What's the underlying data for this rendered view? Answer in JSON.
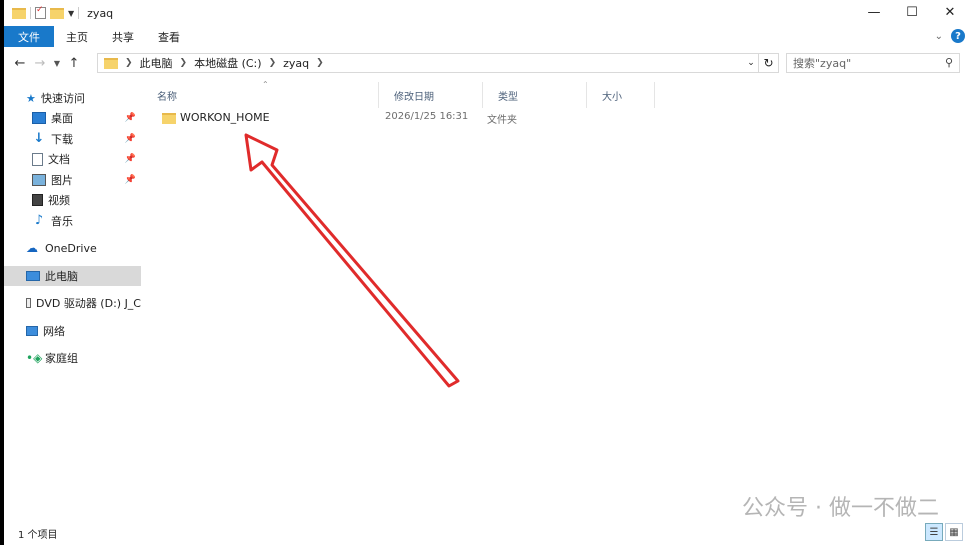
{
  "window": {
    "title": "zyaq",
    "controls": {
      "minimize": "—",
      "maximize": "☐",
      "close": "✕"
    }
  },
  "ribbon": {
    "tabs": [
      "文件",
      "主页",
      "共享",
      "查看"
    ],
    "help": "?"
  },
  "address": {
    "crumbs": [
      "此电脑",
      "本地磁盘 (C:)",
      "zyaq"
    ]
  },
  "search": {
    "placeholder": "搜索\"zyaq\""
  },
  "nav": {
    "quick_access": "快速访问",
    "items": [
      {
        "label": "桌面",
        "icon": "desktop-icon",
        "pinned": true
      },
      {
        "label": "下载",
        "icon": "download-icon",
        "pinned": true
      },
      {
        "label": "文档",
        "icon": "document-icon",
        "pinned": true
      },
      {
        "label": "图片",
        "icon": "picture-icon",
        "pinned": true
      },
      {
        "label": "视频",
        "icon": "video-icon",
        "pinned": false
      },
      {
        "label": "音乐",
        "icon": "music-icon",
        "pinned": false
      }
    ],
    "onedrive": "OneDrive",
    "this_pc": "此电脑",
    "dvd": "DVD 驱动器 (D:) J_C",
    "network": "网络",
    "homegroup": "家庭组"
  },
  "columns": {
    "name": "名称",
    "modified": "修改日期",
    "type": "类型",
    "size": "大小"
  },
  "files": [
    {
      "name": "WORKON_HOME",
      "modified": "2026/1/25 16:31",
      "type": "文件夹",
      "size": ""
    }
  ],
  "status": {
    "count": "1 个项目"
  },
  "watermark": "公众号 · 做一不做二",
  "annotation": {
    "color": "#e02b2b"
  }
}
